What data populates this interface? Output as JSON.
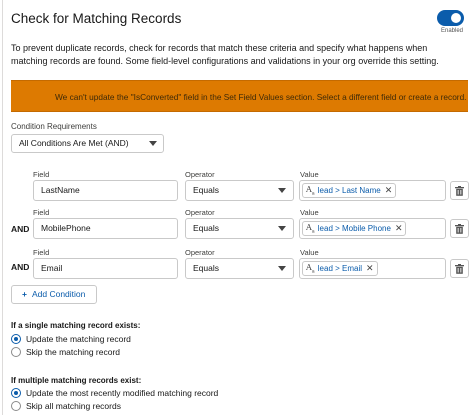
{
  "section_title": "Check for Matching Records",
  "toggle": {
    "label": "Enabled",
    "on": true
  },
  "description": "To prevent duplicate records, check for records that match these criteria and specify what happens when matching records are found. Some field-level configurations and validations in your org override this setting.",
  "warning": "We can't update the \"IsConverted\" field in the Set Field Values section. Select a different field or create a record.",
  "condition_requirements": {
    "label": "Condition Requirements",
    "value": "All Conditions Are Met (AND)"
  },
  "columns": {
    "field": "Field",
    "operator": "Operator",
    "value": "Value"
  },
  "conditions": [
    {
      "prefix": "",
      "field": "LastName",
      "operator": "Equals",
      "value": "lead > Last Name"
    },
    {
      "prefix": "AND",
      "field": "MobilePhone",
      "operator": "Equals",
      "value": "lead > Mobile Phone"
    },
    {
      "prefix": "AND",
      "field": "Email",
      "operator": "Equals",
      "value": "lead > Email"
    }
  ],
  "add_condition_label": "Add Condition",
  "single_match": {
    "heading": "If a single matching record exists:",
    "options": [
      "Update the matching record",
      "Skip the matching record"
    ],
    "selected": 0
  },
  "multiple_match": {
    "heading": "If multiple matching records exist:",
    "options": [
      "Update the most recently modified matching record",
      "Skip all matching records"
    ],
    "selected": 0
  }
}
